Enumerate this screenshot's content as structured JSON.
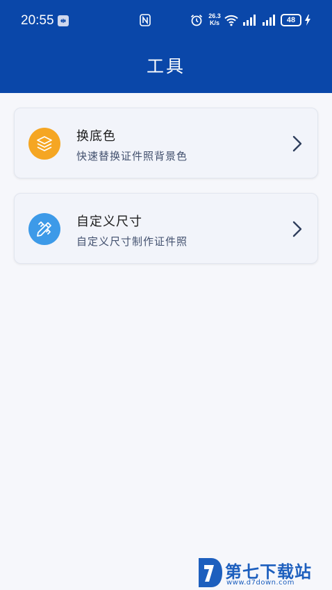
{
  "status_bar": {
    "time": "20:55",
    "net_speed_value": "26.3",
    "net_speed_unit": "K/s",
    "battery": "48",
    "icons": [
      "usb-icon",
      "nfc-icon",
      "alarm-icon",
      "wifi-icon",
      "signal-icon",
      "signal-icon",
      "battery-icon",
      "charging-icon"
    ]
  },
  "header": {
    "title": "工具"
  },
  "tools": [
    {
      "title": "换底色",
      "subtitle": "快速替换证件照背景色",
      "icon": "layers-icon",
      "icon_color": "#f5a623"
    },
    {
      "title": "自定义尺寸",
      "subtitle": "自定义尺寸制作证件照",
      "icon": "ruler-pencil-icon",
      "icon_color": "#3d9ae8"
    }
  ],
  "watermark": {
    "text": "第七下载站",
    "url": "www.d7down.com",
    "color": "#1d5fbe"
  },
  "colors": {
    "header": "#0a47a9",
    "background": "#f6f7fb",
    "card": "#f2f4fa"
  }
}
